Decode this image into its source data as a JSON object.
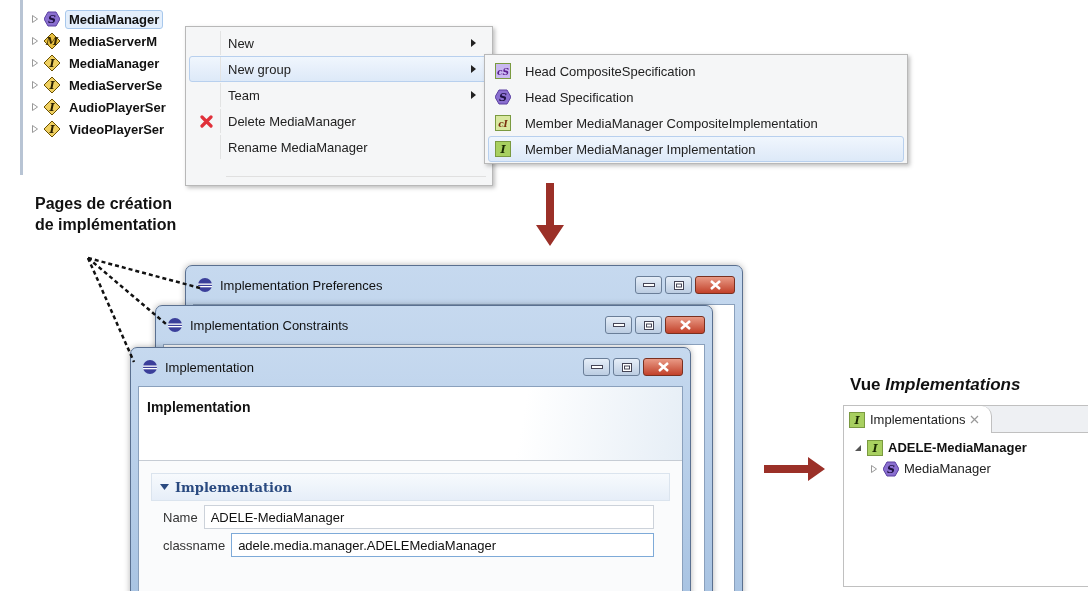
{
  "project_tree": {
    "items": [
      {
        "label": "MediaManager",
        "kind": "spec",
        "icon_text": "S",
        "expanded": false,
        "selected": true
      },
      {
        "label": "MediaServerM",
        "kind": "model",
        "icon_text": "M",
        "expanded": false,
        "selected": false
      },
      {
        "label": "MediaManager",
        "kind": "interface",
        "icon_text": "I",
        "expanded": false,
        "selected": false
      },
      {
        "label": "MediaServerSe",
        "kind": "interface",
        "icon_text": "I",
        "expanded": false,
        "selected": false
      },
      {
        "label": "AudioPlayerSer",
        "kind": "interface",
        "icon_text": "I",
        "expanded": false,
        "selected": false
      },
      {
        "label": "VideoPlayerSer",
        "kind": "interface",
        "icon_text": "I",
        "expanded": false,
        "selected": false
      }
    ]
  },
  "context_menu": {
    "items": [
      {
        "label": "New",
        "kind": "plain",
        "has_submenu": true,
        "selected": false
      },
      {
        "label": "New group",
        "kind": "plain",
        "has_submenu": true,
        "selected": true
      },
      {
        "label": "Team",
        "kind": "plain",
        "has_submenu": true,
        "selected": false
      },
      {
        "label": "Delete MediaManager",
        "kind": "delete",
        "has_submenu": false,
        "selected": false
      },
      {
        "label": "Rename MediaManager",
        "kind": "plain",
        "has_submenu": false,
        "selected": false
      }
    ]
  },
  "submenu": {
    "items": [
      {
        "label": "Head CompositeSpecification",
        "kind": "composite-spec",
        "icon_text": "cS",
        "selected": false
      },
      {
        "label": "Head Specification",
        "kind": "spec",
        "icon_text": "S",
        "selected": false
      },
      {
        "label": "Member MediaManager CompositeImplementation",
        "kind": "composite-impl",
        "icon_text": "cI",
        "selected": false
      },
      {
        "label": "Member MediaManager Implementation",
        "kind": "impl",
        "icon_text": "I",
        "selected": true
      }
    ]
  },
  "annotation": "Pages de création\nde implémentation",
  "windows": [
    {
      "title": "Implementation Preferences"
    },
    {
      "title": "Implementation Constraints"
    },
    {
      "title": "Implementation",
      "page_title": "Implementation",
      "section": {
        "title": "Implementation",
        "expanded": true
      },
      "fields": [
        {
          "label": "Name",
          "value": "ADELE-MediaManager",
          "focused": false
        },
        {
          "label": "classname",
          "value": "adele.media.manager.ADELEMediaManager",
          "focused": true
        }
      ]
    }
  ],
  "view_caption": "Vue *Implementations*",
  "implementations_view": {
    "tab": {
      "label": "Implementations",
      "icon_text": "I"
    },
    "tree": [
      {
        "label": "ADELE-MediaManager",
        "kind": "impl",
        "icon_text": "I",
        "expanded": true,
        "children": [
          {
            "label": "MediaManager",
            "kind": "spec",
            "icon_text": "S",
            "expanded": false
          }
        ]
      }
    ]
  }
}
